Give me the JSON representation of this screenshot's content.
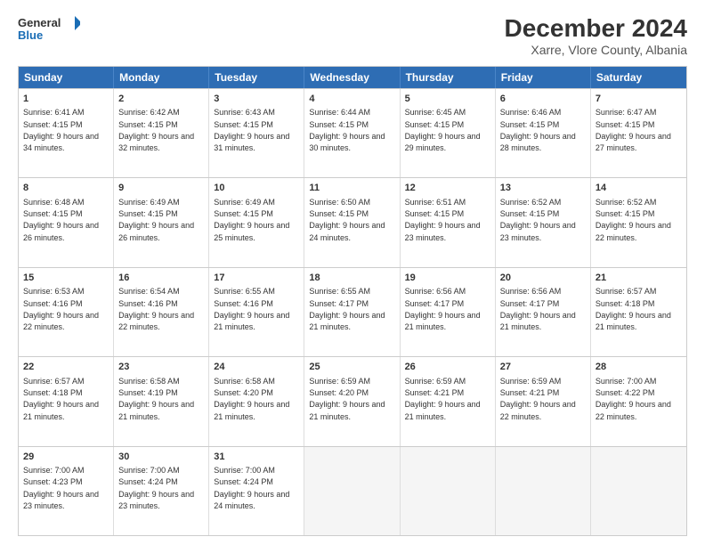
{
  "logo": {
    "line1": "General",
    "line2": "Blue"
  },
  "title": "December 2024",
  "subtitle": "Xarre, Vlore County, Albania",
  "days": [
    "Sunday",
    "Monday",
    "Tuesday",
    "Wednesday",
    "Thursday",
    "Friday",
    "Saturday"
  ],
  "weeks": [
    [
      {
        "num": "1",
        "rise": "6:41 AM",
        "set": "4:15 PM",
        "daylight": "9 hours and 34 minutes."
      },
      {
        "num": "2",
        "rise": "6:42 AM",
        "set": "4:15 PM",
        "daylight": "9 hours and 32 minutes."
      },
      {
        "num": "3",
        "rise": "6:43 AM",
        "set": "4:15 PM",
        "daylight": "9 hours and 31 minutes."
      },
      {
        "num": "4",
        "rise": "6:44 AM",
        "set": "4:15 PM",
        "daylight": "9 hours and 30 minutes."
      },
      {
        "num": "5",
        "rise": "6:45 AM",
        "set": "4:15 PM",
        "daylight": "9 hours and 29 minutes."
      },
      {
        "num": "6",
        "rise": "6:46 AM",
        "set": "4:15 PM",
        "daylight": "9 hours and 28 minutes."
      },
      {
        "num": "7",
        "rise": "6:47 AM",
        "set": "4:15 PM",
        "daylight": "9 hours and 27 minutes."
      }
    ],
    [
      {
        "num": "8",
        "rise": "6:48 AM",
        "set": "4:15 PM",
        "daylight": "9 hours and 26 minutes."
      },
      {
        "num": "9",
        "rise": "6:49 AM",
        "set": "4:15 PM",
        "daylight": "9 hours and 26 minutes."
      },
      {
        "num": "10",
        "rise": "6:49 AM",
        "set": "4:15 PM",
        "daylight": "9 hours and 25 minutes."
      },
      {
        "num": "11",
        "rise": "6:50 AM",
        "set": "4:15 PM",
        "daylight": "9 hours and 24 minutes."
      },
      {
        "num": "12",
        "rise": "6:51 AM",
        "set": "4:15 PM",
        "daylight": "9 hours and 23 minutes."
      },
      {
        "num": "13",
        "rise": "6:52 AM",
        "set": "4:15 PM",
        "daylight": "9 hours and 23 minutes."
      },
      {
        "num": "14",
        "rise": "6:52 AM",
        "set": "4:15 PM",
        "daylight": "9 hours and 22 minutes."
      }
    ],
    [
      {
        "num": "15",
        "rise": "6:53 AM",
        "set": "4:16 PM",
        "daylight": "9 hours and 22 minutes."
      },
      {
        "num": "16",
        "rise": "6:54 AM",
        "set": "4:16 PM",
        "daylight": "9 hours and 22 minutes."
      },
      {
        "num": "17",
        "rise": "6:55 AM",
        "set": "4:16 PM",
        "daylight": "9 hours and 21 minutes."
      },
      {
        "num": "18",
        "rise": "6:55 AM",
        "set": "4:17 PM",
        "daylight": "9 hours and 21 minutes."
      },
      {
        "num": "19",
        "rise": "6:56 AM",
        "set": "4:17 PM",
        "daylight": "9 hours and 21 minutes."
      },
      {
        "num": "20",
        "rise": "6:56 AM",
        "set": "4:17 PM",
        "daylight": "9 hours and 21 minutes."
      },
      {
        "num": "21",
        "rise": "6:57 AM",
        "set": "4:18 PM",
        "daylight": "9 hours and 21 minutes."
      }
    ],
    [
      {
        "num": "22",
        "rise": "6:57 AM",
        "set": "4:18 PM",
        "daylight": "9 hours and 21 minutes."
      },
      {
        "num": "23",
        "rise": "6:58 AM",
        "set": "4:19 PM",
        "daylight": "9 hours and 21 minutes."
      },
      {
        "num": "24",
        "rise": "6:58 AM",
        "set": "4:20 PM",
        "daylight": "9 hours and 21 minutes."
      },
      {
        "num": "25",
        "rise": "6:59 AM",
        "set": "4:20 PM",
        "daylight": "9 hours and 21 minutes."
      },
      {
        "num": "26",
        "rise": "6:59 AM",
        "set": "4:21 PM",
        "daylight": "9 hours and 21 minutes."
      },
      {
        "num": "27",
        "rise": "6:59 AM",
        "set": "4:21 PM",
        "daylight": "9 hours and 22 minutes."
      },
      {
        "num": "28",
        "rise": "7:00 AM",
        "set": "4:22 PM",
        "daylight": "9 hours and 22 minutes."
      }
    ],
    [
      {
        "num": "29",
        "rise": "7:00 AM",
        "set": "4:23 PM",
        "daylight": "9 hours and 23 minutes."
      },
      {
        "num": "30",
        "rise": "7:00 AM",
        "set": "4:24 PM",
        "daylight": "9 hours and 23 minutes."
      },
      {
        "num": "31",
        "rise": "7:00 AM",
        "set": "4:24 PM",
        "daylight": "9 hours and 24 minutes."
      },
      null,
      null,
      null,
      null
    ]
  ]
}
